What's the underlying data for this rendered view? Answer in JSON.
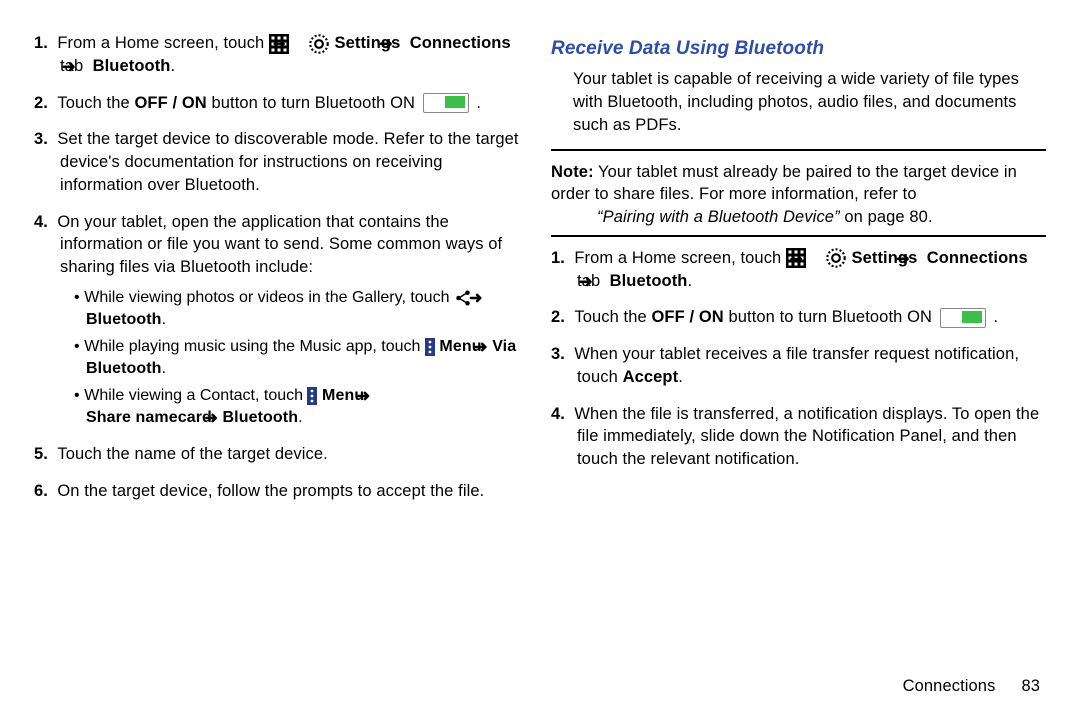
{
  "left": {
    "s1a": "From a Home screen, touch ",
    "s1b": " Settings ",
    "s1c": "Connections",
    "s1d": " tab ",
    "s1e": " Bluetooth",
    "s2a": "Touch the ",
    "s2b": "OFF / ON",
    "s2c": " button to turn Bluetooth ON ",
    "s3": "Set the target device to discoverable mode. Refer to the target device's documentation for instructions on receiving information over Bluetooth.",
    "s4": "On your tablet, open the application that contains the information or file you want to send. Some common ways of sharing files via Bluetooth include:",
    "b1a": "While viewing photos or videos in the Gallery, touch ",
    "b1b": " Bluetooth",
    "b2a": "While playing music using the Music app, touch ",
    "b2b": " Menu ",
    "b2c": "Via Bluetooth",
    "b3a": "While viewing a Contact, touch ",
    "b3b": " Menu ",
    "b3c": "Share namecard ",
    "b3d": " Bluetooth",
    "s5": "Touch the name of the target device.",
    "s6": "On the target device, follow the prompts to accept the file."
  },
  "right": {
    "heading": "Receive Data Using Bluetooth",
    "intro": "Your tablet is capable of receiving a wide variety of file types with Bluetooth, including photos, audio files, and documents such as PDFs.",
    "note_label": "Note:",
    "note_body": " Your tablet must already be paired to the target device in order to share files. For more information, refer to ",
    "note_ref": "“Pairing with a Bluetooth Device” ",
    "note_ref2": "on page 80.",
    "s1a": "From a Home screen, touch ",
    "s1b": " Settings ",
    "s1c": "Connections",
    "s1d": " tab ",
    "s1e": " Bluetooth",
    "s2a": "Touch the ",
    "s2b": "OFF / ON",
    "s2c": " button to turn Bluetooth ON ",
    "s3a": "When your tablet receives a file transfer request notification, touch ",
    "s3b": "Accept",
    "s4": "When the file is transferred, a notification displays. To open the file immediately, slide down the Notification Panel, and then touch the relevant notification."
  },
  "footer": {
    "chapter": "Connections",
    "page": "83"
  },
  "glyph": {
    "arrow": "➜"
  }
}
